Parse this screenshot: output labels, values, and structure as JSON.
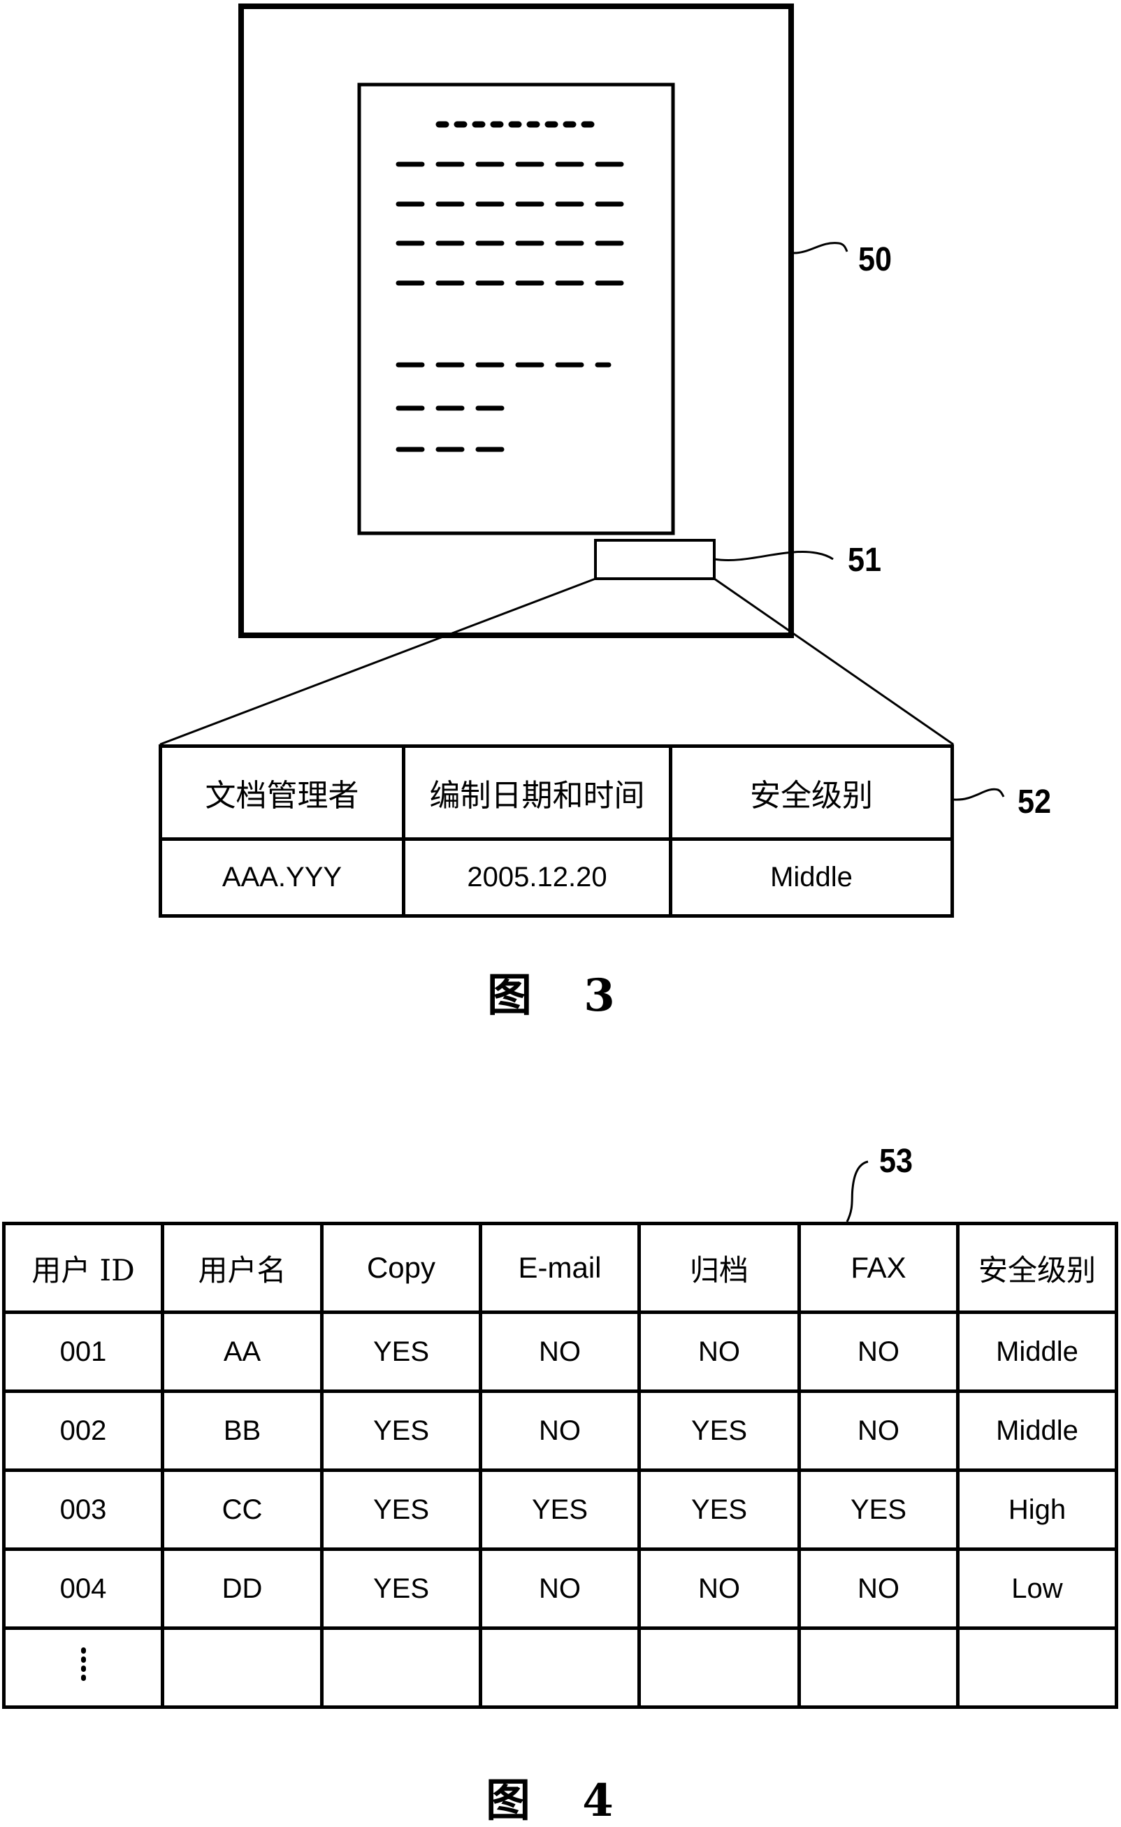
{
  "figure3": {
    "caption": "图 3",
    "refs": {
      "document": "50",
      "info_area": "51",
      "info_table": "52"
    },
    "document_text_lines": {
      "title_dots": 9,
      "paragraph1_rows": 4,
      "paragraph1_dashes_per_row": 6,
      "paragraph2_rows": [
        6,
        3,
        3
      ]
    },
    "info_table": {
      "headers": [
        "文档管理者",
        "编制日期和时间",
        "安全级别"
      ],
      "values": [
        "AAA.YYY",
        "2005.12.20",
        "Middle"
      ]
    }
  },
  "figure4": {
    "caption": "图 4",
    "ref": "53",
    "user_table": {
      "headers": [
        "用户 ID",
        "用户名",
        "Copy",
        "E-mail",
        "归档",
        "FAX",
        "安全级别"
      ],
      "rows": [
        [
          "001",
          "AA",
          "YES",
          "NO",
          "NO",
          "NO",
          "Middle"
        ],
        [
          "002",
          "BB",
          "YES",
          "NO",
          "YES",
          "NO",
          "Middle"
        ],
        [
          "003",
          "CC",
          "YES",
          "YES",
          "YES",
          "YES",
          "High"
        ],
        [
          "004",
          "DD",
          "YES",
          "NO",
          "NO",
          "NO",
          "Low"
        ]
      ],
      "continuation": "⋮"
    }
  }
}
